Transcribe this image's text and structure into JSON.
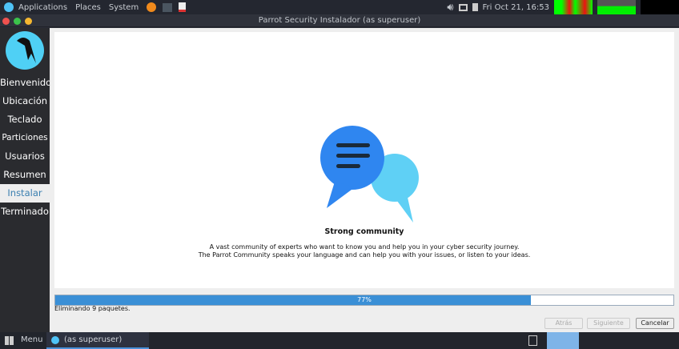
{
  "top_panel": {
    "menus": [
      "Applications",
      "Places",
      "System"
    ],
    "clock": "Fri Oct 21, 16:53"
  },
  "window": {
    "title": "Parrot Security Instalador (as superuser)"
  },
  "sidebar": {
    "items": [
      {
        "label": "Bienvenido"
      },
      {
        "label": "Ubicación"
      },
      {
        "label": "Teclado"
      },
      {
        "label": "Particiones"
      },
      {
        "label": "Usuarios"
      },
      {
        "label": "Resumen"
      },
      {
        "label": "Instalar",
        "active": true
      },
      {
        "label": "Terminado"
      }
    ]
  },
  "slide": {
    "title": "Strong community",
    "line1": "A vast community of experts who want to know you and help you in your cyber security journey.",
    "line2": "The Parrot Community speaks your language and can help you with your issues, or listen to your ideas."
  },
  "progress": {
    "percent": 77,
    "label": "77%",
    "status": "Eliminando 9 paquetes."
  },
  "buttons": {
    "back": "Atrás",
    "next": "Siguiente",
    "cancel": "Cancelar"
  },
  "taskbar": {
    "menu": "Menu",
    "task": "(as superuser)"
  },
  "colors": {
    "accent": "#3a8fd6",
    "bubble_dark": "#2f86f0",
    "bubble_light": "#5fd0f5"
  }
}
